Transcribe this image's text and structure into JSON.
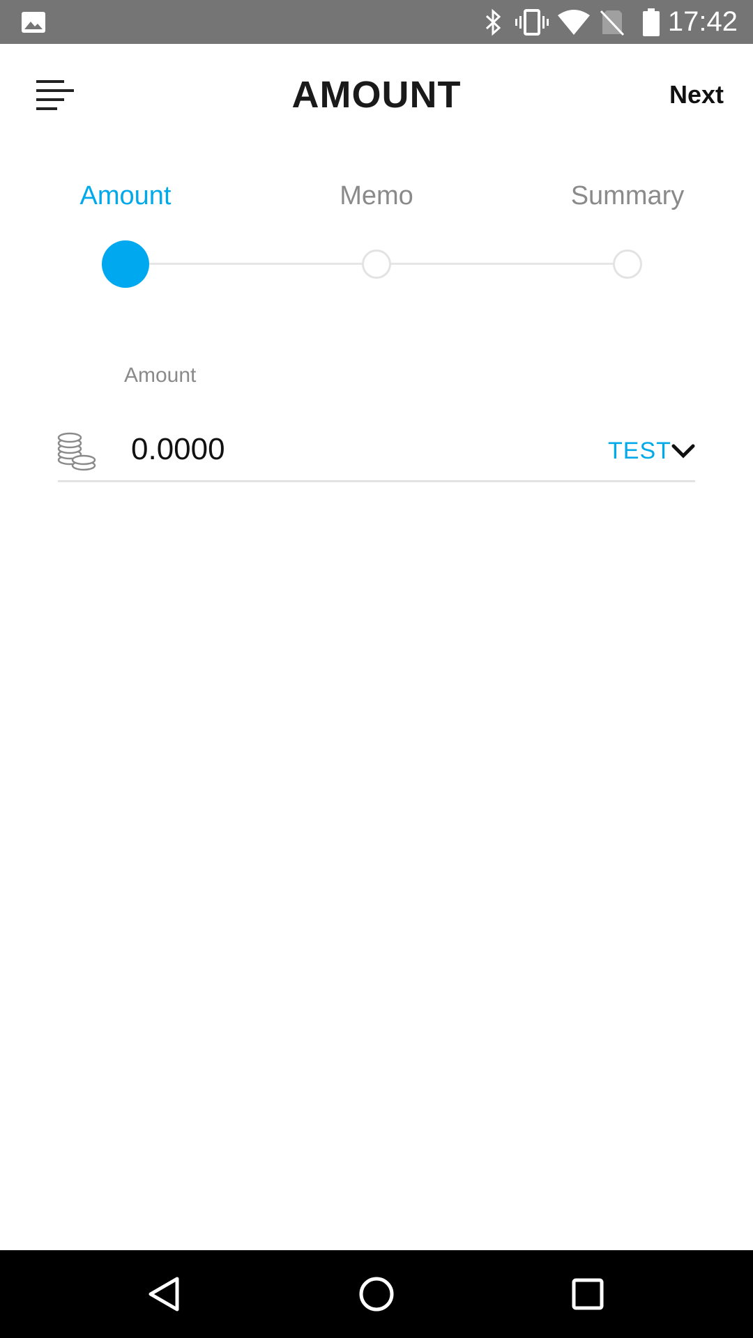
{
  "status_bar": {
    "time": "17:42",
    "icons": [
      "image-icon",
      "bluetooth-icon",
      "vibrate-icon",
      "wifi-icon",
      "no-sim-icon",
      "battery-icon"
    ],
    "background": "#757575"
  },
  "header": {
    "title": "AMOUNT",
    "next_label": "Next",
    "menu_icon": "menu-icon"
  },
  "stepper": {
    "steps": [
      {
        "label": "Amount",
        "active": true
      },
      {
        "label": "Memo",
        "active": false
      },
      {
        "label": "Summary",
        "active": false
      }
    ],
    "accent_color": "#00a9ef"
  },
  "amount_field": {
    "label": "Amount",
    "value": "0.0000",
    "currency": "TEST",
    "icon": "coins-icon",
    "dropdown_icon": "chevron-down-icon"
  },
  "nav_bar": {
    "buttons": [
      "back-icon",
      "home-icon",
      "recents-icon"
    ]
  }
}
